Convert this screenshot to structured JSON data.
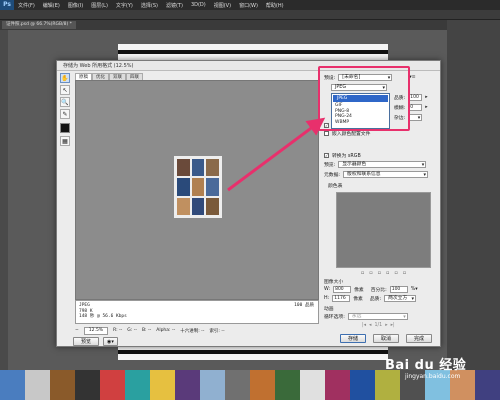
{
  "app": {
    "logo": "Ps",
    "menus": [
      "文件(F)",
      "编辑(E)",
      "图像(I)",
      "图层(L)",
      "文字(Y)",
      "选择(S)",
      "滤镜(T)",
      "3D(D)",
      "视图(V)",
      "窗口(W)",
      "帮助(H)"
    ],
    "doc_tab": "证件照.psd @ 66.7%(RGB/8) *"
  },
  "dialog": {
    "title": "存储为 Web 所用格式 (12.5%)",
    "tabs": [
      "原稿",
      "优化",
      "双联",
      "四联"
    ],
    "info": {
      "format": "JPEG",
      "size": "798 K",
      "time": "148 秒 @ 56.6 Kbps",
      "quality": "100 品质"
    },
    "status": {
      "zoom": "12.5%",
      "r": "R: --",
      "g": "G: --",
      "b": "B: --",
      "alpha": "Alpha: --",
      "hex": "十六进制: --",
      "index": "索引: --"
    },
    "buttons": {
      "preview": "预览",
      "save": "存储",
      "cancel": "取消",
      "done": "完成"
    },
    "preset_label": "预设:",
    "preset_value": "[未命名]",
    "format_value": "JPEG",
    "dropdown_options": [
      "JPEG",
      "GIF",
      "PNG-8",
      "PNG-24",
      "WBMP"
    ],
    "quality_label": "品质:",
    "quality_value": "100",
    "blur_label": "模糊:",
    "blur_value": "0",
    "matte_label": "杂边:",
    "optimized_label": "优化",
    "embed_profile_label": "嵌入颜色配置文件",
    "convert_srgb_label": "转换为 sRGB",
    "preview_label": "预览:",
    "preview_value": "显示器颜色",
    "metadata_label": "元数据:",
    "metadata_value": "版权和联系信息",
    "color_table_label": "颜色表",
    "image_size_label": "图像大小",
    "width_label": "W:",
    "width_value": "800",
    "height_label": "H:",
    "height_value": "1176",
    "pixels_unit": "像素",
    "percent_label": "百分比:",
    "percent_value": "100",
    "quality2_label": "品质:",
    "quality2_value": "两次立方",
    "animation_label": "动画",
    "loop_label": "循环选项:",
    "loop_value": "永远",
    "frame_counter": "1/1"
  },
  "watermark": {
    "brand": "Bai du 经验",
    "url": "jingyan.baidu.com"
  },
  "colors": {
    "highlight": "#e8306c",
    "dropdown_highlight": "#2f67c8"
  },
  "swatch_colors": [
    "#4a7dbf",
    "#c8c8c8",
    "#8a5a2a",
    "#333333",
    "#d04040",
    "#2aa0a0",
    "#e6c040",
    "#5a3a7a",
    "#90b0d0",
    "#707070",
    "#c07030",
    "#3a6a3a",
    "#e0e0e0",
    "#a03060",
    "#2050a0",
    "#b0b040",
    "#505050",
    "#80c0e0",
    "#d09060",
    "#404080"
  ]
}
